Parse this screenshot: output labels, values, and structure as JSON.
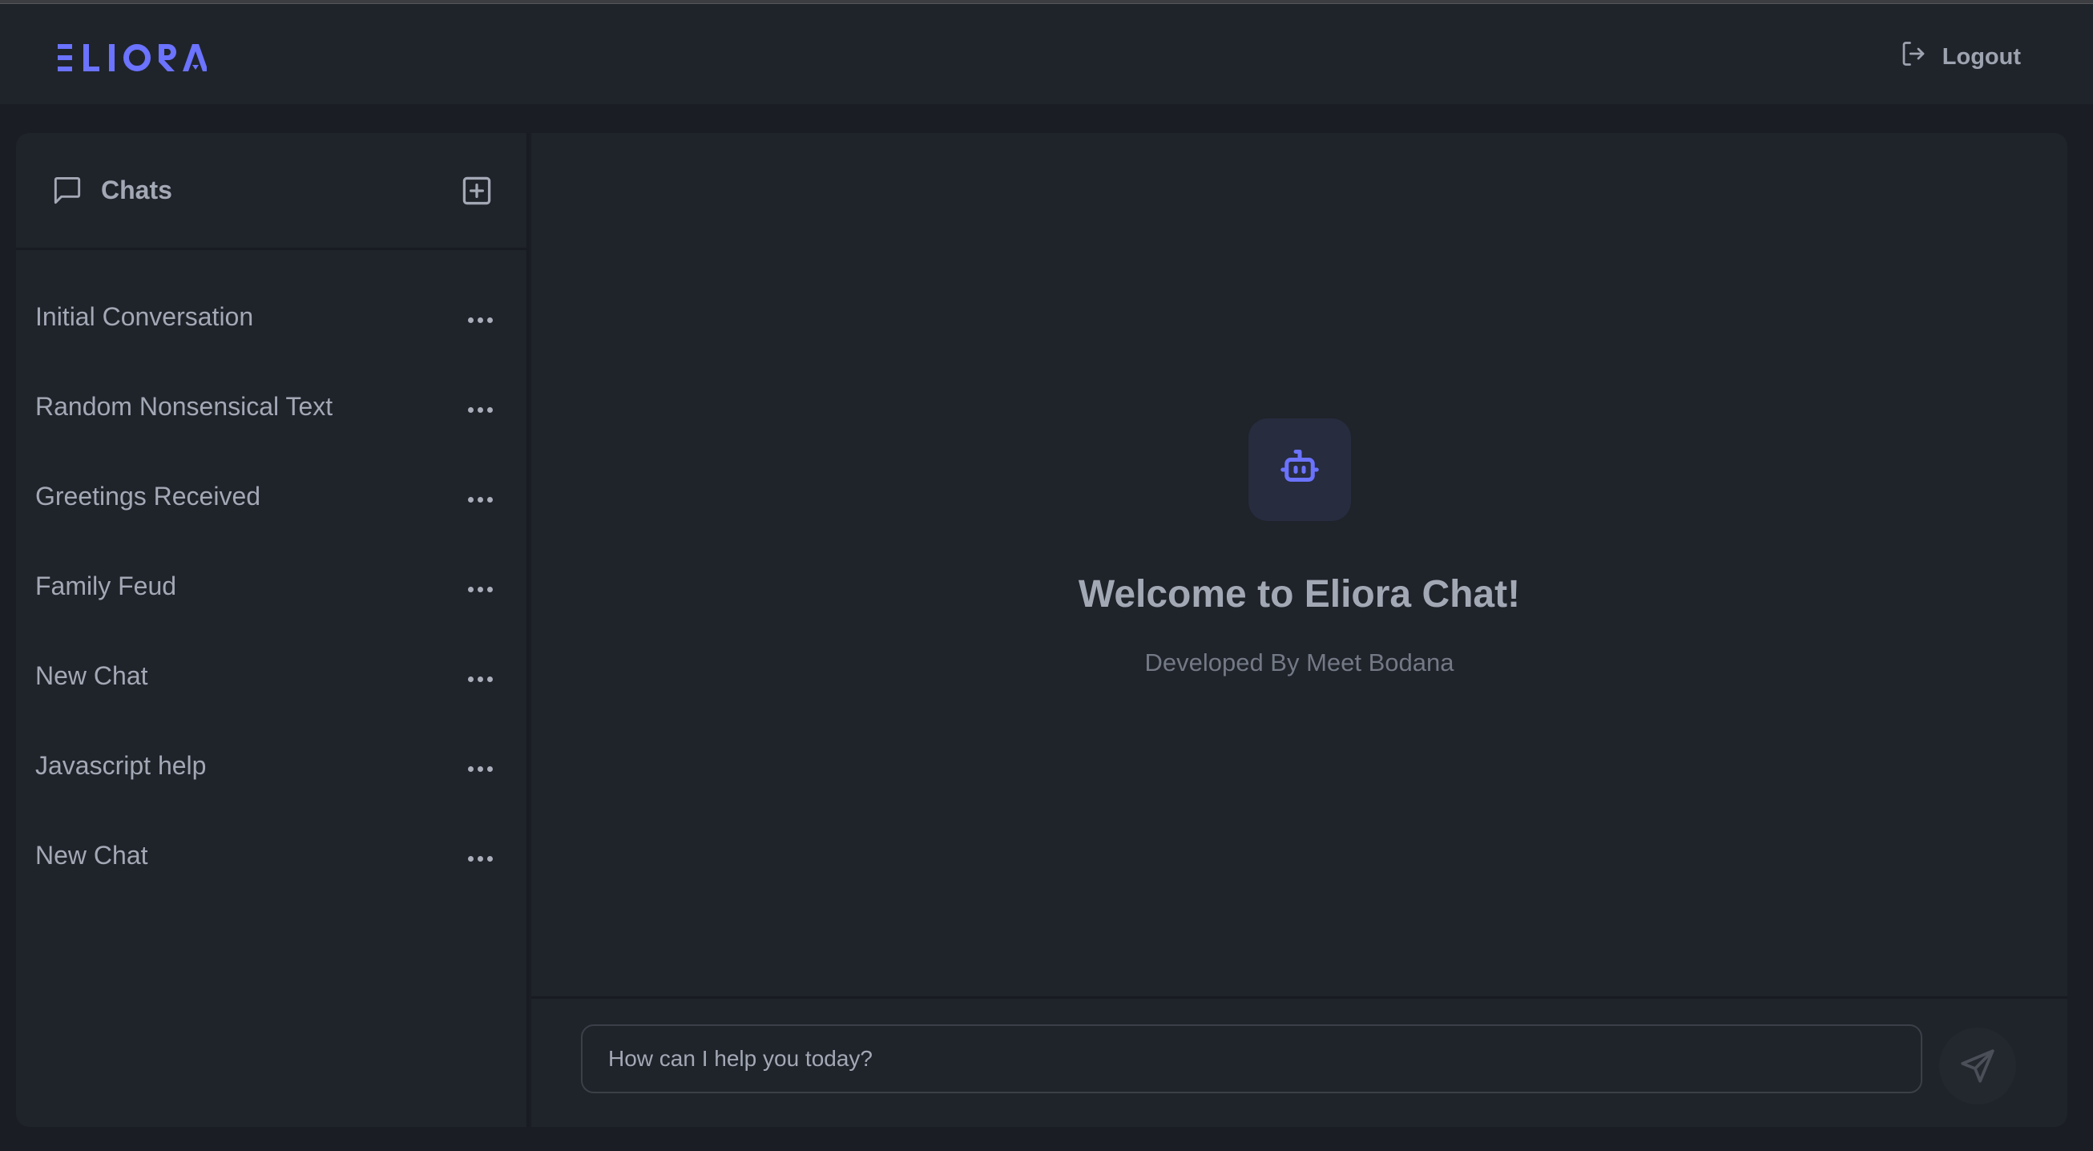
{
  "header": {
    "logo_text": "ELIORA",
    "logout_label": "Logout",
    "logout_icon": "logout-icon"
  },
  "sidebar": {
    "title": "Chats",
    "title_icon": "chat-bubble-icon",
    "new_chat_icon": "plus-square-icon",
    "items": [
      {
        "label": "Initial Conversation"
      },
      {
        "label": "Random Nonsensical Text"
      },
      {
        "label": "Greetings Received"
      },
      {
        "label": "Family Feud"
      },
      {
        "label": "New Chat"
      },
      {
        "label": "Javascript help"
      },
      {
        "label": "New Chat"
      }
    ],
    "item_menu_icon": "more-horizontal-icon"
  },
  "main": {
    "bot_icon": "robot-icon",
    "welcome_title": "Welcome to Eliora Chat!",
    "welcome_subtitle": "Developed By Meet Bodana"
  },
  "composer": {
    "placeholder": "How can I help you today?",
    "value": "",
    "send_icon": "send-icon"
  },
  "colors": {
    "accent": "#6b73ff",
    "background": "#1a1d23",
    "panel": "#1f232a",
    "text": "#a3a8b5",
    "muted_text": "#737985"
  }
}
